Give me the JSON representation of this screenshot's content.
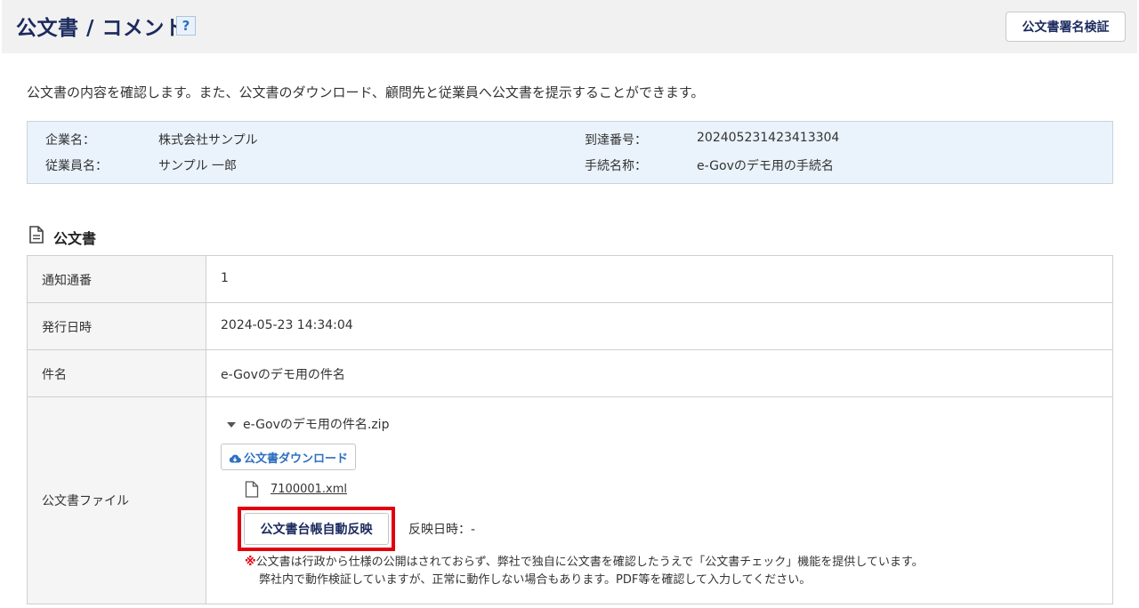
{
  "header": {
    "title": "公文書 / コメント",
    "help_label": "?",
    "verify_button_label": "公文書署名検証"
  },
  "intro_text": "公文書の内容を確認します。また、公文書のダウンロード、顧問先と従業員へ公文書を提示することができます。",
  "info": {
    "company_label": "企業名：",
    "company_value": "株式会社サンプル",
    "employee_label": "従業員名：",
    "employee_value": "サンプル 一郎",
    "arrival_label": "到達番号：",
    "arrival_value": "20240523142341330​4",
    "procedure_label": "手続名称：",
    "procedure_value": "e-Govのデモ用の手続名"
  },
  "section": {
    "title": "公文書"
  },
  "table": {
    "notice_no_label": "通知通番",
    "notice_no_value": "1",
    "issued_label": "発行日時",
    "issued_value": "2024-05-23 14:34:04",
    "subject_label": "件名",
    "subject_value": "e-Govのデモ用の件名",
    "file_label": "公文書ファイル",
    "zip_name": "e-Govのデモ用の件名.zip",
    "download_label": "公文書ダウンロード",
    "xml_name": "7100001.xml",
    "reflect_button_label": "公文書台帳自動反映",
    "reflect_date_text": "反映日時：-",
    "note_mark": "※",
    "note_line1": "公文書は行政から仕様の公開はされておらず、弊社で独自に公文書を確認したうえで「公文書チェック」機能を提供しています。",
    "note_line2": "弊社内で動作検証していますが、正常に動作しない場合もあります。PDF等を確認して入力してください。"
  },
  "colors": {
    "title": "#1b2a5e",
    "accent_blue": "#2f6fbf",
    "highlight_red": "#e0000f",
    "info_bg": "#eaf3fb"
  }
}
